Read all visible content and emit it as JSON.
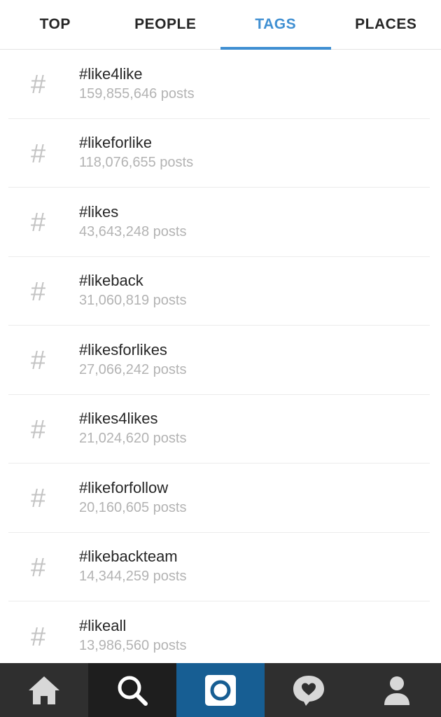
{
  "tabs": [
    {
      "label": "TOP"
    },
    {
      "label": "PEOPLE"
    },
    {
      "label": "TAGS"
    },
    {
      "label": "PLACES"
    }
  ],
  "active_tab": "TAGS",
  "hash_symbol": "#",
  "results": [
    {
      "tag": "#like4like",
      "count": "159,855,646 posts"
    },
    {
      "tag": "#likeforlike",
      "count": "118,076,655 posts"
    },
    {
      "tag": "#likes",
      "count": "43,643,248 posts"
    },
    {
      "tag": "#likeback",
      "count": "31,060,819 posts"
    },
    {
      "tag": "#likesforlikes",
      "count": "27,066,242 posts"
    },
    {
      "tag": "#likes4likes",
      "count": "21,024,620 posts"
    },
    {
      "tag": "#likeforfollow",
      "count": "20,160,605 posts"
    },
    {
      "tag": "#likebackteam",
      "count": "14,344,259 posts"
    },
    {
      "tag": "#likeall",
      "count": "13,986,560 posts"
    }
  ],
  "bottom_nav": [
    {
      "icon": "home-icon"
    },
    {
      "icon": "search-icon",
      "selected": true
    },
    {
      "icon": "camera-icon"
    },
    {
      "icon": "activity-heart-icon"
    },
    {
      "icon": "profile-icon"
    }
  ],
  "colors": {
    "accent": "#3f8fd2",
    "camera_bg": "#175e93",
    "nav_bg": "#2f2f2f",
    "nav_selected_bg": "#1e1e1e"
  }
}
